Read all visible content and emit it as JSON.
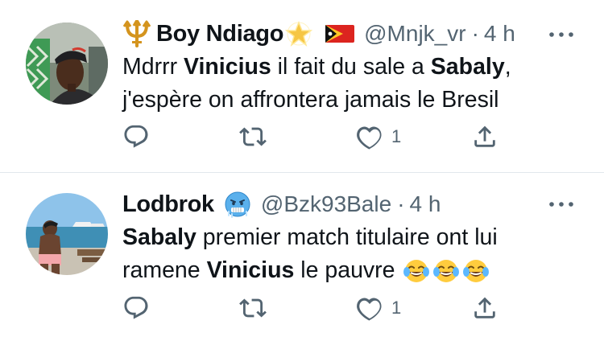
{
  "tweets": [
    {
      "name": "Boy Ndiago",
      "handle": "@Mnjk_vr",
      "separator": "·",
      "time": "4 h",
      "text_lines": [
        [
          {
            "t": "Mdrrr ",
            "b": false
          },
          {
            "t": "Vinicius",
            "b": true
          },
          {
            "t": " il fait du sale a ",
            "b": false
          },
          {
            "t": "Sabaly",
            "b": true
          },
          {
            "t": ",",
            "b": false
          }
        ],
        [
          {
            "t": "j'espère on affrontera jamais le Bresil",
            "b": false
          }
        ]
      ],
      "name_emojis": [
        "trident-emoji",
        "glowing-star-emoji",
        "flag-timor-leste-emoji"
      ],
      "likes": "1",
      "avatar": "profile-photo-man-cap"
    },
    {
      "name": "Lodbrok",
      "handle": "@Bzk93Bale",
      "separator": "·",
      "time": "4 h",
      "text_lines": [
        [
          {
            "t": "Sabaly",
            "b": true
          },
          {
            "t": " premier match titulaire ont lui",
            "b": false
          }
        ],
        [
          {
            "t": "ramene ",
            "b": false
          },
          {
            "t": "Vinicius",
            "b": true
          },
          {
            "t": " le pauvre ",
            "b": false
          }
        ]
      ],
      "name_emojis": [
        "cold-face-emoji"
      ],
      "text_emojis": [
        "tears-of-joy-emoji",
        "tears-of-joy-emoji",
        "tears-of-joy-emoji"
      ],
      "likes": "1",
      "avatar": "profile-photo-boat-sea"
    }
  ],
  "colors": {
    "text": "#0f1419",
    "secondary": "#536471",
    "divider": "#e1e8ed",
    "star": "#f6c644",
    "trident": "#d4941e"
  },
  "icons": {
    "reply": "reply-icon",
    "retweet": "retweet-icon",
    "like": "heart-icon",
    "share": "share-icon",
    "more": "more-icon"
  }
}
